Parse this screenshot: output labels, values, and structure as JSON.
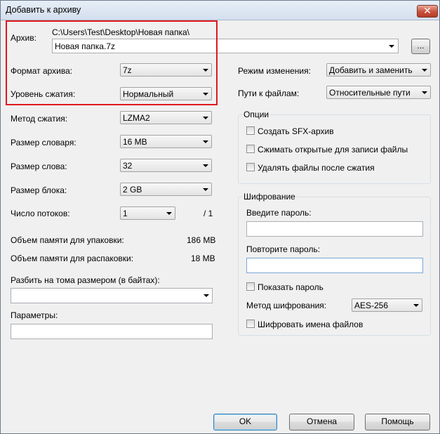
{
  "window": {
    "title": "Добавить к архиву",
    "close_glyph": "✕"
  },
  "archive": {
    "label": "Архив:",
    "path": "C:\\Users\\Test\\Desktop\\Новая папка\\",
    "name": "Новая папка.7z",
    "browse_label": "..."
  },
  "left": {
    "format_label": "Формат архива:",
    "format_value": "7z",
    "level_label": "Уровень сжатия:",
    "level_value": "Нормальный",
    "method_label": "Метод сжатия:",
    "method_value": "LZMA2",
    "dict_label": "Размер словаря:",
    "dict_value": "16 MB",
    "word_label": "Размер слова:",
    "word_value": "32",
    "block_label": "Размер блока:",
    "block_value": "2 GB",
    "threads_label": "Число потоков:",
    "threads_value": "1",
    "threads_total": "/ 1",
    "mem_pack_label": "Объем памяти для упаковки:",
    "mem_pack_value": "186 MB",
    "mem_unpack_label": "Объем памяти для распаковки:",
    "mem_unpack_value": "18 MB",
    "split_label": "Разбить на тома размером (в байтах):",
    "split_value": "",
    "params_label": "Параметры:",
    "params_value": ""
  },
  "right": {
    "update_label": "Режим изменения:",
    "update_value": "Добавить и заменить",
    "paths_label": "Пути к файлам:",
    "paths_value": "Относительные пути",
    "options_legend": "Опции",
    "opt_sfx": "Создать SFX-архив",
    "opt_shared": "Сжимать открытые для записи файлы",
    "opt_delete": "Удалять файлы после сжатия",
    "enc_legend": "Шифрование",
    "pwd_label": "Введите пароль:",
    "pwd2_label": "Повторите пароль:",
    "show_pwd": "Показать пароль",
    "enc_method_label": "Метод шифрования:",
    "enc_method_value": "AES-256",
    "enc_names": "Шифровать имена файлов"
  },
  "buttons": {
    "ok": "OK",
    "cancel": "Отмена",
    "help": "Помощь"
  },
  "colors": {
    "highlight": "#e0181e",
    "close": "#c8503a"
  }
}
